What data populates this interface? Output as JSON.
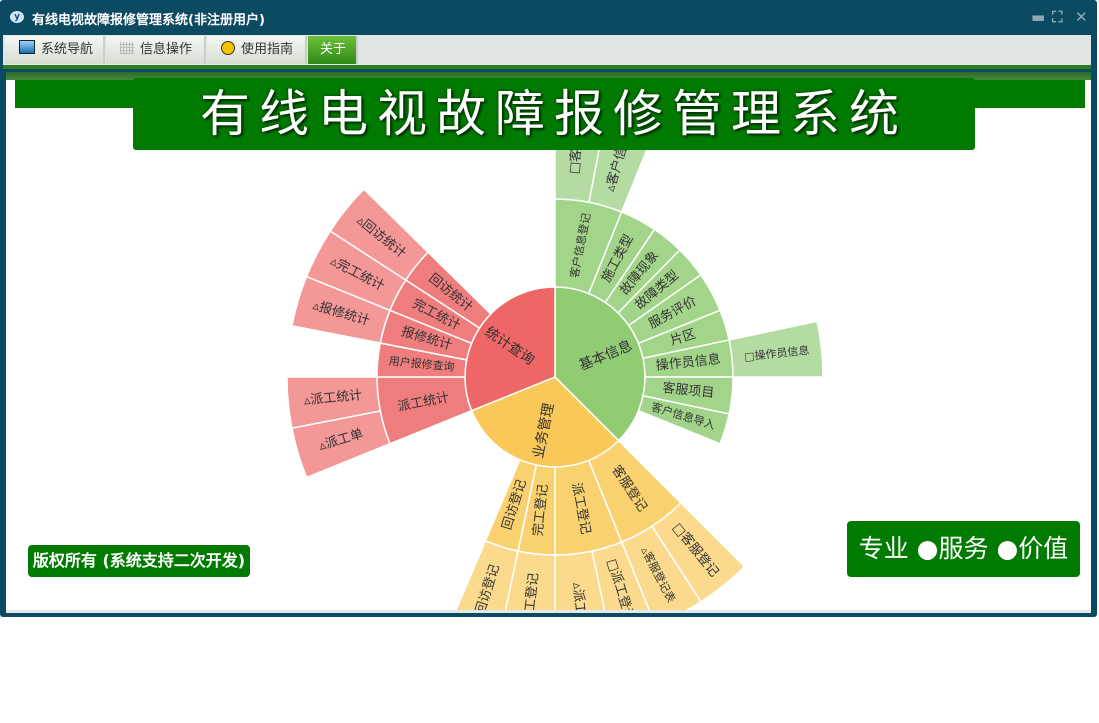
{
  "window": {
    "title": "有线电视故障报修管理系统(非注册用户)",
    "controls": {
      "minimize": "minimize-icon",
      "restore": "restore-icon",
      "close": "close-icon"
    }
  },
  "tabs": [
    {
      "label": "系统导航",
      "icon": "monitor-icon"
    },
    {
      "label": "信息操作",
      "icon": "grid-icon"
    },
    {
      "label": "使用指南",
      "icon": "help-icon"
    },
    {
      "label": "关于",
      "active": true
    }
  ],
  "banner": {
    "title": "有线电视故障报修管理系统"
  },
  "footer": {
    "copyright": "版权所有 (系统支持二次开发)",
    "motto": "专业 ●服务 ●价值"
  },
  "colors": {
    "frame": "#0c4a62",
    "brand_green": "#007a00",
    "green": "#91cc75",
    "yellow": "#fac858",
    "red": "#ee6666"
  },
  "chart_data": {
    "type": "sunburst",
    "total": 360,
    "nodes": [
      {
        "name": "基本信息",
        "value": 135,
        "color": [
          "#91cc75",
          "#a2d48a",
          "#b4dca2"
        ],
        "children": [
          {
            "name": "客户信息登记",
            "value": 22,
            "children": [
              {
                "name": "□客户",
                "value": 11
              },
              {
                "name": "▵客户信息",
                "value": 11
              }
            ]
          },
          {
            "name": "施工类型",
            "value": 12
          },
          {
            "name": "故障现象",
            "value": 10.5
          },
          {
            "name": "故障类型",
            "value": 10.5
          },
          {
            "name": "服务评价",
            "value": 13
          },
          {
            "name": "片区",
            "value": 10
          },
          {
            "name": "操作员信息",
            "value": 12,
            "children": [
              {
                "name": "□操作员信息",
                "value": 12
              }
            ]
          },
          {
            "name": "客服项目",
            "value": 12
          },
          {
            "name": "客户信息导入",
            "value": 10
          }
        ]
      },
      {
        "name": "业务管理",
        "value": 113,
        "color": [
          "#fac858",
          "#fad16f",
          "#fbda8e"
        ],
        "children": [
          {
            "name": "客服登记",
            "value": 23,
            "children": [
              {
                "name": "□客服登记",
                "value": 12
              },
              {
                "name": "▵客服登记表",
                "value": 11
              }
            ]
          },
          {
            "name": "派工登记",
            "value": 22,
            "children": [
              {
                "name": "□派工登记",
                "value": 10
              },
              {
                "name": "▵派工",
                "value": 12
              }
            ]
          },
          {
            "name": "完工登记",
            "value": 12,
            "children": [
              {
                "name": "完工登记",
                "value": 12
              }
            ]
          },
          {
            "name": "回访登记",
            "value": 11,
            "children": [
              {
                "name": "回访登记",
                "value": 11
              }
            ]
          }
        ]
      },
      {
        "name": "统计查询",
        "value": 112,
        "color": [
          "#ee6666",
          "#f07d7d",
          "#f39797"
        ],
        "children": [
          {
            "name": "派工统计",
            "value": 22,
            "children": [
              {
                "name": "▵派工单",
                "value": 11
              },
              {
                "name": "▵派工统计",
                "value": 11
              }
            ]
          },
          {
            "name": "用户报修查询",
            "value": 11
          },
          {
            "name": "报修统计",
            "value": 11,
            "children": [
              {
                "name": "▵报修统计",
                "value": 11
              }
            ]
          },
          {
            "name": "完工统计",
            "value": 11,
            "children": [
              {
                "name": "▵完工统计",
                "value": 11
              }
            ]
          },
          {
            "name": "回访统计",
            "value": 11.5,
            "children": [
              {
                "name": "▵回访统计",
                "value": 11.5
              }
            ]
          }
        ]
      }
    ]
  }
}
